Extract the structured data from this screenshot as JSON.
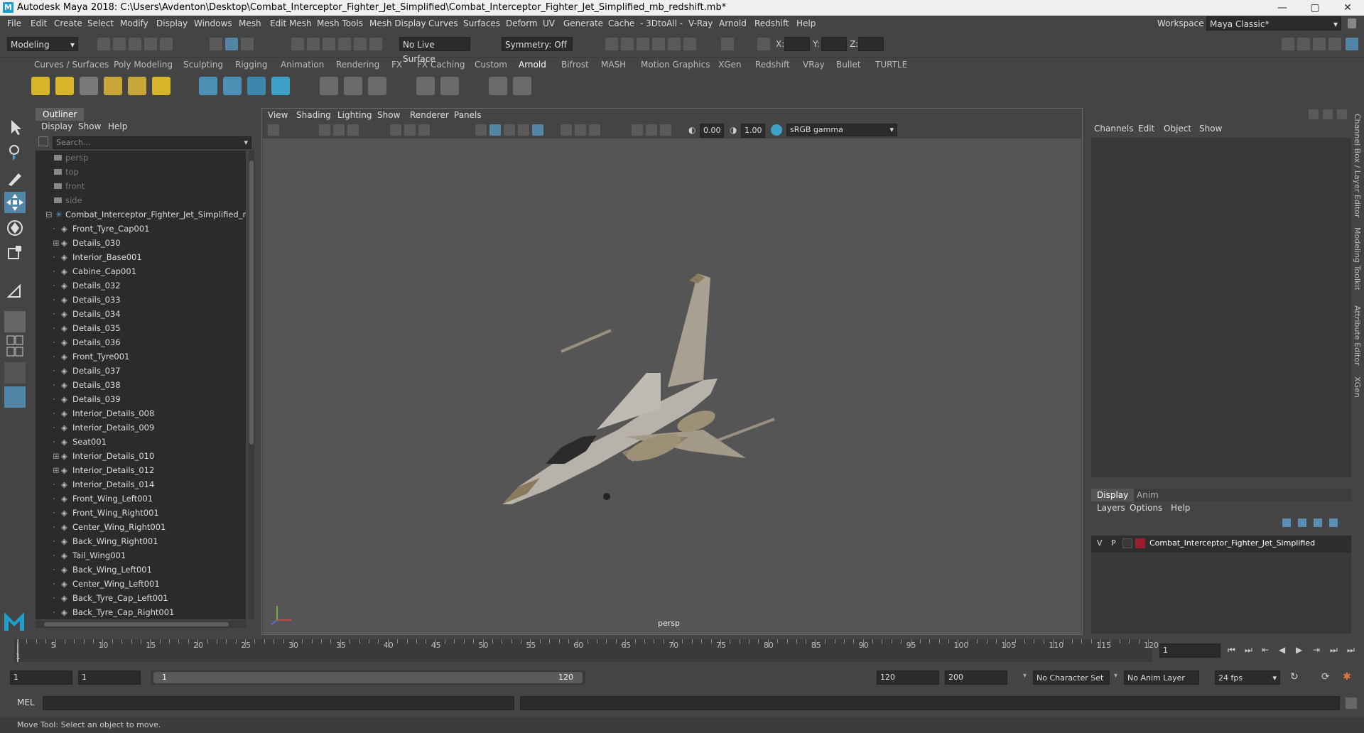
{
  "window": {
    "title": "Autodesk Maya 2018: C:\\Users\\Avdenton\\Desktop\\Combat_Interceptor_Fighter_Jet_Simplified\\Combat_Interceptor_Fighter_Jet_Simplified_mb_redshift.mb*",
    "logo": "M",
    "minimize": "—",
    "maximize": "▢",
    "close": "✕"
  },
  "menubar": {
    "items": [
      "File",
      "Edit",
      "Create",
      "Select",
      "Modify",
      "Display",
      "Windows",
      "Mesh",
      "Edit Mesh",
      "Mesh Tools",
      "Mesh Display",
      "Curves",
      "Surfaces",
      "Deform",
      "UV",
      "Generate",
      "Cache",
      "- 3DtoAll -",
      "V-Ray",
      "Arnold",
      "Redshift",
      "Help"
    ],
    "workspace_label": "Workspace :",
    "workspace_value": "Maya Classic*"
  },
  "statusline": {
    "mode": "Modeling",
    "live_surface": "No Live Surface",
    "symmetry": "Symmetry: Off",
    "x_label": "X:",
    "y_label": "Y:",
    "z_label": "Z:"
  },
  "shelf": {
    "tabs": [
      "Curves / Surfaces",
      "Poly Modeling",
      "Sculpting",
      "Rigging",
      "Animation",
      "Rendering",
      "FX",
      "FX Caching",
      "Custom",
      "Arnold",
      "Bifrost",
      "MASH",
      "Motion Graphics",
      "XGen",
      "Redshift",
      "VRay",
      "Bullet",
      "TURTLE"
    ],
    "active_tab": "Arnold"
  },
  "outliner": {
    "title": "Outliner",
    "menu": [
      "Display",
      "Show",
      "Help"
    ],
    "search_placeholder": "Search...",
    "cameras": [
      "persp",
      "top",
      "front",
      "side"
    ],
    "root": "Combat_Interceptor_Fighter_Jet_Simplified_ncl",
    "children": [
      {
        "name": "Front_Tyre_Cap001",
        "expandable": false
      },
      {
        "name": "Details_030",
        "expandable": true
      },
      {
        "name": "Interior_Base001",
        "expandable": false
      },
      {
        "name": "Cabine_Cap001",
        "expandable": false
      },
      {
        "name": "Details_032",
        "expandable": false
      },
      {
        "name": "Details_033",
        "expandable": false
      },
      {
        "name": "Details_034",
        "expandable": false
      },
      {
        "name": "Details_035",
        "expandable": false
      },
      {
        "name": "Details_036",
        "expandable": false
      },
      {
        "name": "Front_Tyre001",
        "expandable": false
      },
      {
        "name": "Details_037",
        "expandable": false
      },
      {
        "name": "Details_038",
        "expandable": false
      },
      {
        "name": "Details_039",
        "expandable": false
      },
      {
        "name": "Interior_Details_008",
        "expandable": false
      },
      {
        "name": "Interior_Details_009",
        "expandable": false
      },
      {
        "name": "Seat001",
        "expandable": false
      },
      {
        "name": "Interior_Details_010",
        "expandable": true
      },
      {
        "name": "Interior_Details_012",
        "expandable": true
      },
      {
        "name": "Interior_Details_014",
        "expandable": false
      },
      {
        "name": "Front_Wing_Left001",
        "expandable": false
      },
      {
        "name": "Front_Wing_Right001",
        "expandable": false
      },
      {
        "name": "Center_Wing_Right001",
        "expandable": false
      },
      {
        "name": "Back_Wing_Right001",
        "expandable": false
      },
      {
        "name": "Tail_Wing001",
        "expandable": false
      },
      {
        "name": "Back_Wing_Left001",
        "expandable": false
      },
      {
        "name": "Center_Wing_Left001",
        "expandable": false
      },
      {
        "name": "Back_Tyre_Cap_Left001",
        "expandable": false
      },
      {
        "name": "Back_Tyre_Cap_Right001",
        "expandable": false
      }
    ]
  },
  "viewport": {
    "menu": [
      "View",
      "Shading",
      "Lighting",
      "Show",
      "Renderer",
      "Panels"
    ],
    "exposure": "0.00",
    "gamma": "1.00",
    "color_space": "sRGB gamma",
    "camera_label": "persp"
  },
  "channelbox": {
    "menu": [
      "Channels",
      "Edit",
      "Object",
      "Show"
    ],
    "layer_tabs": [
      "Display",
      "Anim"
    ],
    "layer_menu": [
      "Layers",
      "Options",
      "Help"
    ],
    "layer": {
      "v": "V",
      "p": "P",
      "name": "Combat_Interceptor_Fighter_Jet_Simplified",
      "color": "#9b1c2c"
    },
    "side_tabs": [
      "Channel Box / Layer Editor",
      "Modeling Toolkit",
      "Attribute Editor",
      "XGen"
    ]
  },
  "timeslider": {
    "ticks": [
      5,
      10,
      15,
      20,
      25,
      30,
      35,
      40,
      45,
      50,
      55,
      60,
      65,
      70,
      75,
      80,
      85,
      90,
      95,
      100,
      105,
      110,
      115,
      120
    ],
    "start_label": "1",
    "current_frame": "1"
  },
  "rangeslider": {
    "start": "1",
    "inner_start": "1",
    "range_start_label": "1",
    "range_end_label": "120",
    "end": "120",
    "anim_end": "200",
    "character_set": "No Character Set",
    "anim_layer": "No Anim Layer",
    "fps": "24 fps"
  },
  "cmdline": {
    "lang": "MEL"
  },
  "helpline": {
    "text": "Move Tool: Select an object to move."
  },
  "colors": {
    "bg": "#444444",
    "panel_dark": "#2b2b2b",
    "accent": "#5285a6",
    "maya_blue": "#1e9ecb"
  }
}
